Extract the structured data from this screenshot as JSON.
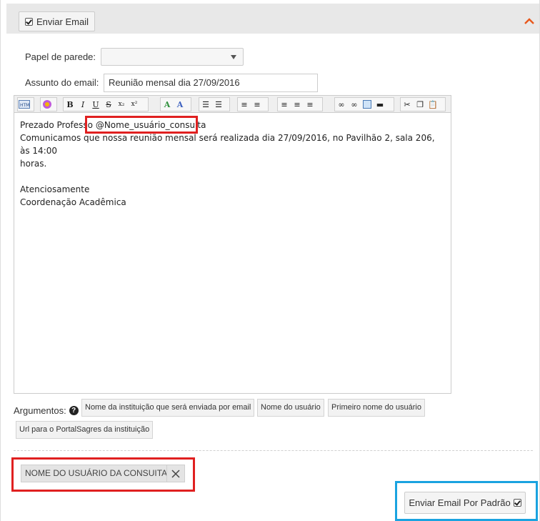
{
  "header": {
    "send_email_label": "Enviar Email",
    "send_email_checked": true,
    "collapse_icon": "chevron-up-icon"
  },
  "form": {
    "wallpaper_label": "Papel de parede:",
    "wallpaper_value": "",
    "subject_label": "Assunto do email:",
    "subject_value": "Reunião mensal dia 27/09/2016"
  },
  "toolbar": {
    "buttons": [
      "html-icon",
      "color-wheel-icon",
      "bold-icon",
      "italic-icon",
      "underline-icon",
      "strikethrough-icon",
      "subscript-icon",
      "superscript-icon",
      "font-color-icon",
      "highlight-icon",
      "ordered-list-icon",
      "unordered-list-icon",
      "outdent-icon",
      "indent-icon",
      "align-left-icon",
      "align-center-icon",
      "align-right-icon",
      "link-icon",
      "unlink-icon",
      "image-icon",
      "horizontal-rule-icon",
      "cut-icon",
      "copy-icon",
      "paste-icon"
    ]
  },
  "editor": {
    "line1_prefix": "Prezado Professo",
    "line1_variable": "@Nome_usuário_consulta",
    "line2": "Comunicamos que nossa reunião mensal será realizada dia 27/09/2016, no Pavilhão 2, sala 206, às 14:00",
    "line3": "horas.",
    "line4": "Atenciosamente",
    "line5": "Coordenação Acadêmica"
  },
  "arguments": {
    "label": "Argumentos:",
    "help_icon": "question-circle-icon",
    "chips": [
      "Nome da instituição que será enviada por email",
      "Nome do usuário",
      "Primeiro nome do usuário",
      "Url para o PortalSagres da instituição"
    ]
  },
  "selected_tag": {
    "label": "NOME DO USUÁRIO DA CONSUITA",
    "remove_icon": "close-icon"
  },
  "default_button": {
    "label": "Enviar Email Por Padrão",
    "checked": true
  },
  "colors": {
    "highlight_red": "#e02020",
    "highlight_blue": "#1aa3e0",
    "accent_orange": "#e8581c"
  }
}
